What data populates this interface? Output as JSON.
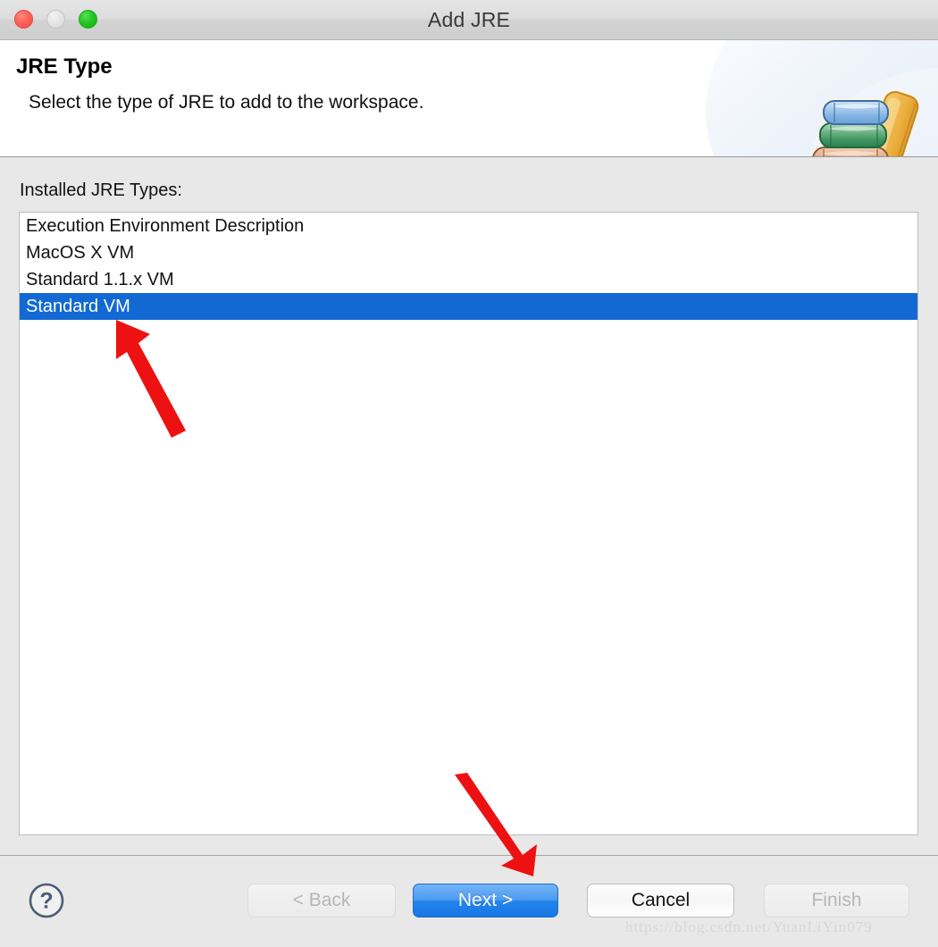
{
  "window": {
    "title": "Add JRE",
    "controls": [
      {
        "name": "close",
        "label": ""
      },
      {
        "name": "minimize",
        "label": ""
      },
      {
        "name": "maximize",
        "label": ""
      }
    ]
  },
  "header": {
    "title": "JRE Type",
    "description": "Select the type of JRE to add to the workspace.",
    "icon": "books-icon"
  },
  "body": {
    "list_label": "Installed JRE Types:",
    "items": [
      {
        "label": "Execution Environment Description",
        "selected": false
      },
      {
        "label": "MacOS X VM",
        "selected": false
      },
      {
        "label": "Standard 1.1.x VM",
        "selected": false
      },
      {
        "label": "Standard VM",
        "selected": true
      }
    ]
  },
  "footer": {
    "help_label": "?",
    "buttons": [
      {
        "name": "back",
        "label": "< Back",
        "state": "disabled"
      },
      {
        "name": "next",
        "label": "Next >",
        "state": "primary"
      },
      {
        "name": "cancel",
        "label": "Cancel",
        "state": "default"
      },
      {
        "name": "finish",
        "label": "Finish",
        "state": "disabled"
      }
    ]
  },
  "annotations": {
    "arrow_color": "#ee1111",
    "arrow_top_target": "Standard VM",
    "arrow_bottom_target": "Next >"
  },
  "watermark": "https://blog.csdn.net/YuanLiYin079",
  "colors": {
    "selection_blue": "#1269d3",
    "primary_button_blue": "#2384ec",
    "window_chrome": "#e8e8e8",
    "help_icon": "#4a5d75"
  }
}
